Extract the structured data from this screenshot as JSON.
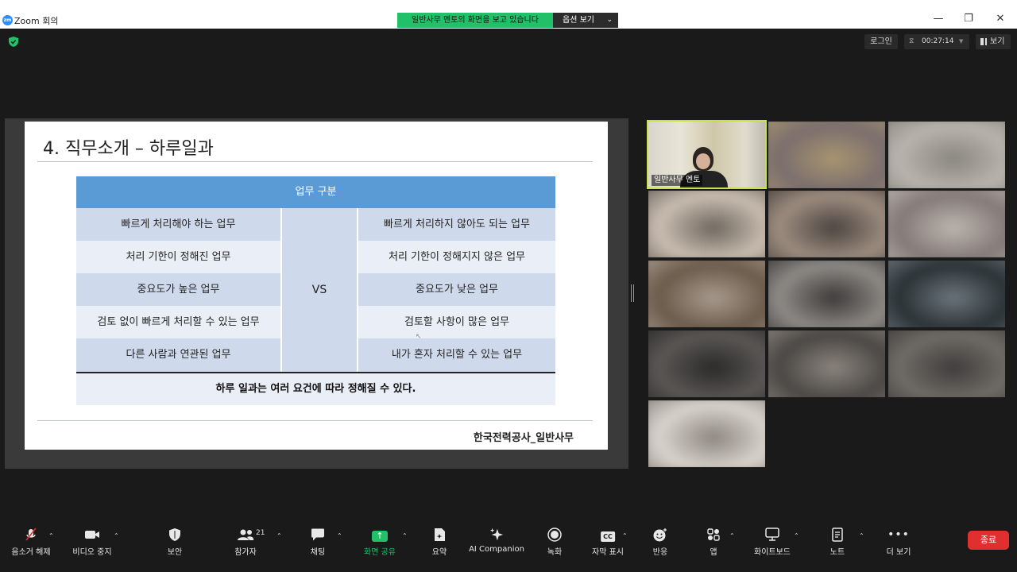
{
  "window": {
    "title": "Zoom 회의",
    "logo_text": "zm",
    "minimize": "—",
    "maximize": "❐",
    "close": "✕"
  },
  "share_banner": {
    "text": "일반사무 멘토의 화면을 보고 있습니다",
    "options_label": "옵션 보기",
    "options_chevron": "⌄"
  },
  "header": {
    "login_label": "로그인",
    "timer": "00:27:14",
    "view_label": "보기"
  },
  "slide": {
    "title": "4. 직무소개 – 하루일과",
    "table_header": "업무 구분",
    "vs_label": "VS",
    "rows": [
      {
        "left": "빠르게 처리해야 하는 업무",
        "right": "빠르게 처리하지 않아도 되는 업무"
      },
      {
        "left": "처리 기한이 정해진 업무",
        "right": "처리 기한이 정해지지 않은 업무"
      },
      {
        "left": "중요도가 높은 업무",
        "right": "중요도가 낮은 업무"
      },
      {
        "left": "검토 없이 빠르게 처리할 수 있는 업무",
        "right": "검토할 사항이 많은 업무"
      },
      {
        "left": "다른 사람과 연관된 업무",
        "right": "내가 혼자 처리할 수 있는 업무"
      }
    ],
    "summary": "하루 일과는 여러 요건에 따라 정해질 수 있다.",
    "footer": "한국전력공사_일반사무"
  },
  "gallery": {
    "active_name": "일반사무 멘토",
    "tile_colors": [
      [
        "#7a6e6e",
        "#a8956f"
      ],
      [
        "#b9b3ad",
        "#8a8780"
      ],
      [
        "#c9bdb0",
        "#6f675f"
      ],
      [
        "#9d8c7f",
        "#4b4540"
      ],
      [
        "#837a78",
        "#bcb5ae"
      ],
      [
        "#6b5b4a",
        "#a89a8e"
      ],
      [
        "#8e8a86",
        "#3d3a39"
      ],
      [
        "#2b3236",
        "#6a757b"
      ],
      [
        "#5a5754",
        "#2a2a2a"
      ],
      [
        "#4a4744",
        "#8b847e"
      ],
      [
        "#6f6b66",
        "#3f3d3c"
      ],
      [
        "#d8d3cc",
        "#8d8780"
      ]
    ]
  },
  "toolbar": {
    "mute": "음소거 해제",
    "video": "비디오 중지",
    "security": "보안",
    "participants": "참가자",
    "participants_count": "21",
    "chat": "채팅",
    "share": "화면 공유",
    "summary": "요약",
    "ai": "AI Companion",
    "record": "녹화",
    "captions": "자막 표시",
    "captions_icon": "CC",
    "reactions": "반응",
    "apps": "앱",
    "whiteboard": "화이트보드",
    "notes": "노트",
    "more": "더 보기",
    "end": "종료"
  }
}
